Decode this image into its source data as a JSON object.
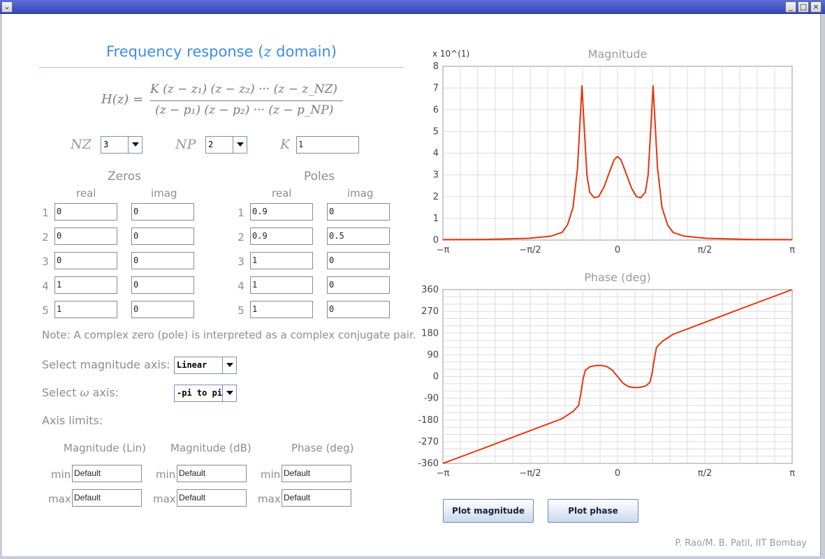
{
  "window": {
    "menu_icon": "chevron-down-icon",
    "controls": [
      "minimize-icon",
      "maximize-icon",
      "close-icon"
    ]
  },
  "title": {
    "prefix": "Frequency response (",
    "z": "z",
    "suffix": " domain)"
  },
  "formula": {
    "lhs": "H(z) =",
    "numerator": "K (z − z₁) (z − z₂) ··· (z − z_NZ)",
    "denominator": "(z − p₁) (z − p₂) ··· (z − p_NP)"
  },
  "params": {
    "nz_label": "NZ",
    "nz_value": "3",
    "np_label": "NP",
    "np_value": "2",
    "k_label": "K",
    "k_value": "1"
  },
  "zeros": {
    "title": "Zeros",
    "real_label": "real",
    "imag_label": "imag",
    "rows": [
      {
        "n": "1",
        "real": "0",
        "imag": "0"
      },
      {
        "n": "2",
        "real": "0",
        "imag": "0"
      },
      {
        "n": "3",
        "real": "0",
        "imag": "0"
      },
      {
        "n": "4",
        "real": "1",
        "imag": "0"
      },
      {
        "n": "5",
        "real": "1",
        "imag": "0"
      }
    ]
  },
  "poles": {
    "title": "Poles",
    "real_label": "real",
    "imag_label": "imag",
    "rows": [
      {
        "n": "1",
        "real": "0.9",
        "imag": "0"
      },
      {
        "n": "2",
        "real": "0.9",
        "imag": "0.5"
      },
      {
        "n": "3",
        "real": "1",
        "imag": "0"
      },
      {
        "n": "4",
        "real": "1",
        "imag": "0"
      },
      {
        "n": "5",
        "real": "1",
        "imag": "0"
      }
    ]
  },
  "note": "Note: A complex zero (pole) is interpreted as a complex conjugate pair.",
  "axis_select": {
    "mag_label": "Select magnitude axis:",
    "mag_value": "Linear",
    "omega_label_pre": "Select ",
    "omega_symbol": "ω",
    "omega_label_post": " axis:",
    "omega_value": "-pi to pi"
  },
  "limits": {
    "title": "Axis limits:",
    "col_mag_lin": "Magnitude (Lin)",
    "col_mag_db": "Magnitude (dB)",
    "col_phase": "Phase (deg)",
    "min_label": "min",
    "max_label": "max",
    "mag_lin_min": "Default",
    "mag_lin_max": "Default",
    "mag_db_min": "Default",
    "mag_db_max": "Default",
    "phase_min": "Default",
    "phase_max": "Default"
  },
  "buttons": {
    "plot_magnitude": "Plot magnitude",
    "plot_phase": "Plot phase"
  },
  "credit": "P. Rao/M. B. Patil, IIT Bombay",
  "colors": {
    "curve": "#e8340f",
    "accent": "#3d8de8",
    "grid": "#dcdcdc"
  },
  "chart_data": [
    {
      "type": "line",
      "title": "Magnitude",
      "scale_note": "x 10^(1)",
      "x_ticks": [
        "−π",
        "−π/2",
        "0",
        "π/2",
        "π"
      ],
      "ylim": [
        0,
        8
      ],
      "y_ticks": [
        "0",
        "1",
        "2",
        "3",
        "4",
        "5",
        "6",
        "7",
        "8"
      ],
      "series": [
        {
          "x": [
            -3.14,
            -2.4,
            -1.6,
            -1.2,
            -1.0,
            -0.9,
            -0.8,
            -0.72,
            -0.68,
            -0.64,
            -0.6,
            -0.55,
            -0.5,
            -0.42,
            -0.34,
            -0.25,
            -0.15,
            -0.06,
            0,
            0.06,
            0.15,
            0.25,
            0.34,
            0.42,
            0.5,
            0.55,
            0.6,
            0.64,
            0.68,
            0.72,
            0.8,
            0.9,
            1.0,
            1.2,
            1.6,
            2.4,
            3.14
          ],
          "y": [
            0.02,
            0.03,
            0.08,
            0.18,
            0.35,
            0.7,
            1.5,
            3.3,
            5.2,
            7.1,
            5.2,
            3.0,
            2.2,
            1.95,
            2.0,
            2.4,
            3.1,
            3.7,
            3.85,
            3.7,
            3.1,
            2.4,
            2.0,
            1.95,
            2.2,
            3.0,
            5.2,
            7.1,
            5.2,
            3.3,
            1.5,
            0.7,
            0.35,
            0.18,
            0.08,
            0.03,
            0.02
          ]
        }
      ],
      "grid": true
    },
    {
      "type": "line",
      "title": "Phase (deg)",
      "x_ticks": [
        "−π",
        "−π/2",
        "0",
        "π/2",
        "π"
      ],
      "ylim": [
        -360,
        360
      ],
      "y_ticks": [
        "360",
        "270",
        "180",
        "90",
        "0",
        "-90",
        "-180",
        "-270",
        "-360"
      ],
      "series": [
        {
          "x": [
            -3.14,
            -2.5,
            -2.0,
            -1.5,
            -1.0,
            -0.8,
            -0.7,
            -0.66,
            -0.62,
            -0.58,
            -0.5,
            -0.4,
            -0.3,
            -0.2,
            -0.1,
            0,
            0.1,
            0.2,
            0.3,
            0.4,
            0.5,
            0.58,
            0.62,
            0.66,
            0.7,
            0.8,
            1.0,
            1.5,
            2.0,
            2.5,
            3.14
          ],
          "y": [
            -360,
            -305,
            -262,
            -218,
            -175,
            -145,
            -120,
            -70,
            -10,
            25,
            40,
            45,
            46,
            42,
            28,
            0,
            -28,
            -42,
            -46,
            -45,
            -40,
            -25,
            10,
            70,
            120,
            145,
            175,
            218,
            262,
            305,
            360
          ]
        }
      ],
      "grid": true
    }
  ]
}
